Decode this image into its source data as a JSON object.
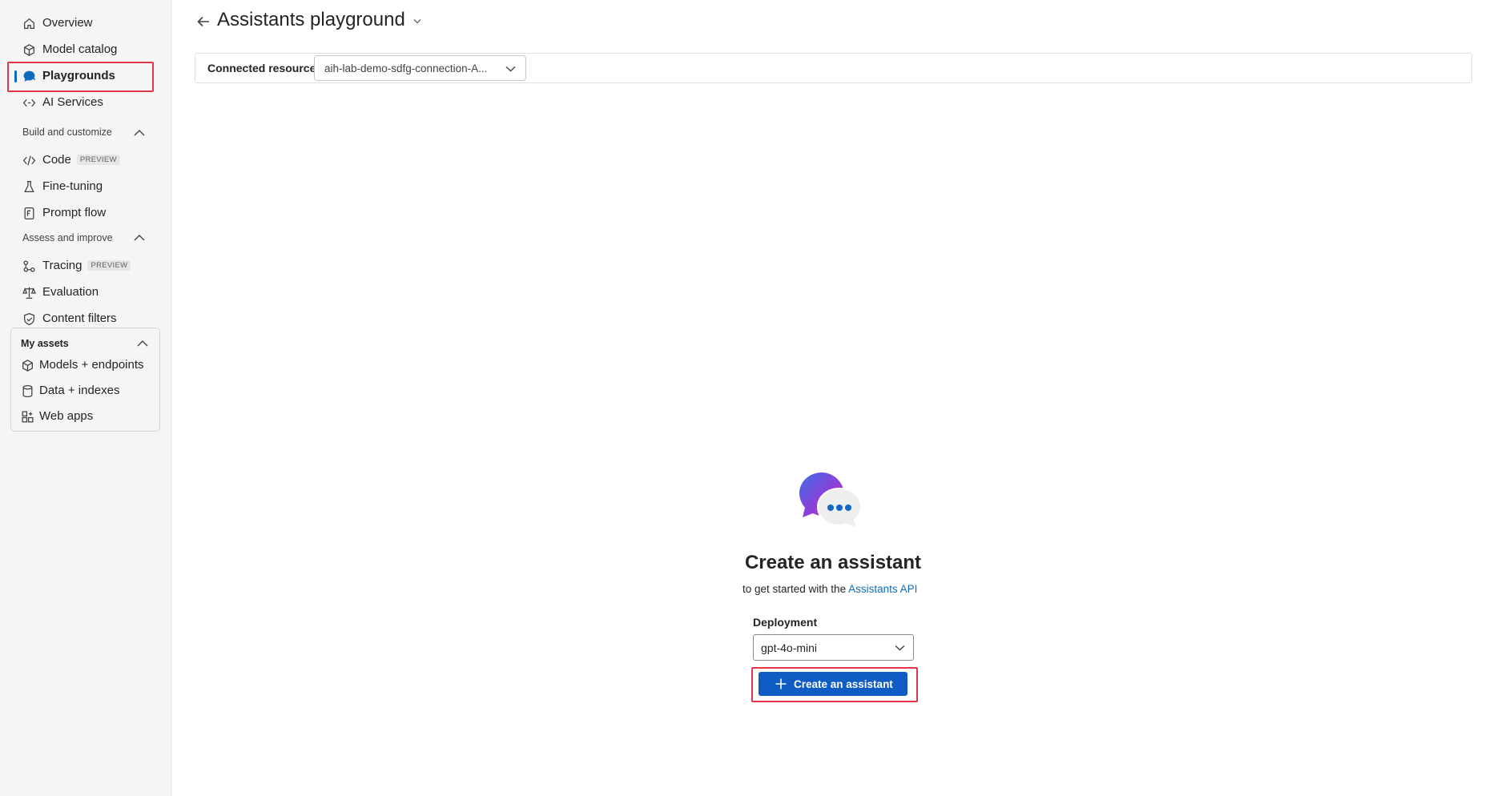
{
  "sidebar": {
    "top_items": [
      {
        "label": "Overview",
        "icon": "home-icon"
      },
      {
        "label": "Model catalog",
        "icon": "cube-icon"
      },
      {
        "label": "Playgrounds",
        "icon": "chat-icon"
      },
      {
        "label": "AI Services",
        "icon": "services-icon"
      }
    ],
    "sections": [
      {
        "title": "Build and customize",
        "items": [
          {
            "label": "Code",
            "badge": "PREVIEW",
            "icon": "code-icon"
          },
          {
            "label": "Fine-tuning",
            "icon": "flask-icon"
          },
          {
            "label": "Prompt flow",
            "icon": "flow-icon"
          }
        ]
      },
      {
        "title": "Assess and improve",
        "items": [
          {
            "label": "Tracing",
            "badge": "PREVIEW",
            "icon": "tracing-icon"
          },
          {
            "label": "Evaluation",
            "icon": "scale-icon"
          },
          {
            "label": "Content filters",
            "icon": "shield-icon"
          }
        ]
      }
    ],
    "assets": {
      "title": "My assets",
      "items": [
        {
          "label": "Models + endpoints",
          "icon": "cube-outline-icon"
        },
        {
          "label": "Data + indexes",
          "icon": "database-icon"
        },
        {
          "label": "Web apps",
          "icon": "apps-icon"
        }
      ]
    },
    "active_item": "Playgrounds"
  },
  "header": {
    "title": "Assistants playground",
    "connected_resource_label": "Connected resource",
    "connected_resource_value": "aih-lab-demo-sdfg-connection-A..."
  },
  "main": {
    "heading": "Create an assistant",
    "subtitle_prefix": "to get started with the ",
    "subtitle_link": "Assistants API",
    "deployment_label": "Deployment",
    "deployment_value": "gpt-4o-mini",
    "create_button_label": "Create an assistant"
  },
  "colors": {
    "accent": "#0f6cbd",
    "button": "#0f5cc4",
    "highlight": "#e0354a",
    "sidebar_bg": "#f5f5f5"
  }
}
